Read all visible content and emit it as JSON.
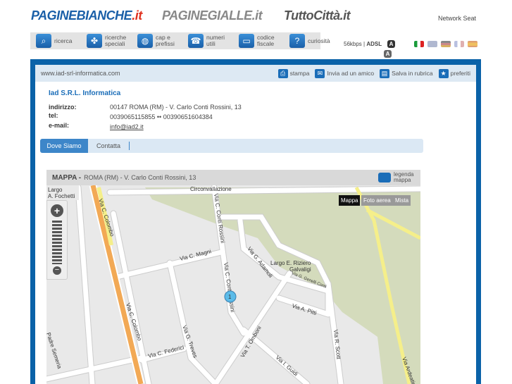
{
  "header": {
    "logos": {
      "paginebianche": "PAGINEBIANCHE",
      "paginebianche_tld": ".it",
      "paginegialle": "PAGINEGIALLE.it",
      "tuttocitta": "TuttoCittà.it"
    },
    "network": "Network Seat",
    "nav": [
      {
        "label": "ricerca",
        "icon": "search-icon"
      },
      {
        "label": "ricerche speciali",
        "icon": "clover-icon"
      },
      {
        "label": "cap e prefissi",
        "icon": "globe-icon"
      },
      {
        "label": "numeri utili",
        "icon": "phone-icon"
      },
      {
        "label": "codice fiscale",
        "icon": "card-icon"
      },
      {
        "label": "curiosità",
        "icon": "curiosity-icon"
      }
    ],
    "speed_56": "56kbps",
    "speed_adsl": "ADSL",
    "font_btn": "A",
    "flags": [
      {
        "name": "italian",
        "color": "#1a9a3a"
      },
      {
        "name": "english",
        "color": "#b0b8d0"
      },
      {
        "name": "german",
        "color": "#d8b060"
      },
      {
        "name": "french",
        "color": "#b8c0e0"
      },
      {
        "name": "spanish",
        "color": "#f0c060"
      }
    ]
  },
  "card": {
    "url": "www.iad-srl-informatica.com",
    "actions": [
      {
        "label": "stampa",
        "icon": "print-icon"
      },
      {
        "label": "Invia ad un amico",
        "icon": "mail-icon"
      },
      {
        "label": "Salva in rubrica",
        "icon": "folder-icon"
      },
      {
        "label": "preferiti",
        "icon": "star-icon"
      }
    ],
    "company": "Iad S.R.L. Informatica",
    "fields": {
      "address_label": "indirizzo:",
      "address": "00147 ROMA (RM) - V. Carlo Conti Rossini, 13",
      "tel_label": "tel:",
      "tel": "0039065115855 •• 00390651604384",
      "email_label": "e-mail:",
      "email": "info@iad2.it"
    },
    "tabs": [
      "Dove Siamo",
      "Contatta"
    ]
  },
  "map": {
    "title": "MAPPA -",
    "address": "ROMA (RM) - V. Carlo Conti Rossini, 13",
    "legend": "legenda mappa",
    "modes": [
      "Mappa",
      "Foto aerea",
      "Mista"
    ],
    "marker": "1",
    "streets": [
      "Largo",
      "A. Fochetti",
      "Via C. Colombo",
      "Via C. Colombo",
      "Circonvallazione",
      "Via C. Conti Rossini",
      "Via C. Conti Rossini",
      "Via C. Magni",
      "Via G. Adamoli",
      "Largo E. Riziero",
      "Galvaligi",
      "Via G. Genelli Conti",
      "Via A. Pitti",
      "Via T. Omboni",
      "Via R. Scott",
      "Via I. Guidi",
      "Via G. Treves",
      "Via C. Federici",
      "Padre Semeria",
      "Via Ardeatina"
    ]
  }
}
